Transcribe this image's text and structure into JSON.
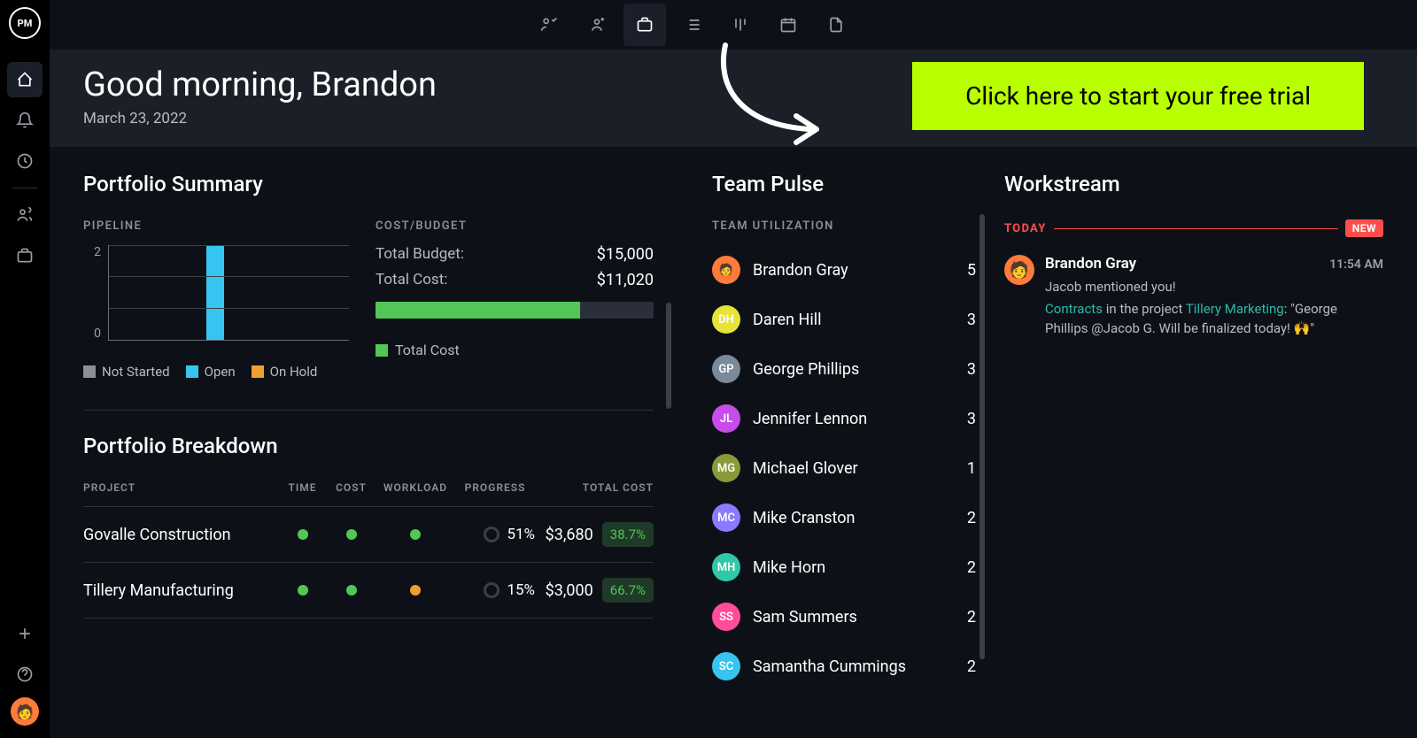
{
  "logo": "PM",
  "header": {
    "greeting": "Good morning, Brandon",
    "date": "March 23, 2022"
  },
  "cta": "Click here to start your free trial",
  "portfolio": {
    "title": "Portfolio Summary",
    "pipeline_label": "PIPELINE",
    "costbudget_label": "COST/BUDGET",
    "budget_label": "Total Budget:",
    "budget_value": "$15,000",
    "cost_label": "Total Cost:",
    "cost_value": "$11,020",
    "bar_legend": "Total Cost",
    "legend": {
      "not_started": "Not Started",
      "open": "Open",
      "on_hold": "On Hold"
    }
  },
  "chart_data": {
    "type": "bar",
    "categories": [
      "Not Started",
      "Open",
      "On Hold"
    ],
    "values": [
      0,
      3,
      0
    ],
    "ylim": [
      0,
      3
    ],
    "yticks": [
      0,
      2
    ],
    "colors": {
      "Not Started": "#8a8f99",
      "Open": "#36c5f0",
      "On Hold": "#f0a030"
    },
    "title": "Pipeline"
  },
  "breakdown": {
    "title": "Portfolio Breakdown",
    "headers": {
      "project": "PROJECT",
      "time": "TIME",
      "cost": "COST",
      "workload": "WORKLOAD",
      "progress": "PROGRESS",
      "total": "TOTAL COST"
    },
    "rows": [
      {
        "project": "Govalle Construction",
        "time": "green",
        "cost": "green",
        "workload": "green",
        "progress": "51%",
        "total": "$3,680",
        "pct": "38.7%"
      },
      {
        "project": "Tillery Manufacturing",
        "time": "green",
        "cost": "green",
        "workload": "orange",
        "progress": "15%",
        "total": "$3,000",
        "pct": "66.7%"
      }
    ]
  },
  "team": {
    "title": "Team Pulse",
    "subtitle": "TEAM UTILIZATION",
    "members": [
      {
        "initials": "",
        "name": "Brandon Gray",
        "count": "5",
        "color": "#ff7b3a",
        "emoji": "🧑"
      },
      {
        "initials": "DH",
        "name": "Daren Hill",
        "count": "3",
        "color": "#e8e337"
      },
      {
        "initials": "GP",
        "name": "George Phillips",
        "count": "3",
        "color": "#7a8a9a"
      },
      {
        "initials": "JL",
        "name": "Jennifer Lennon",
        "count": "3",
        "color": "#c84de8"
      },
      {
        "initials": "MG",
        "name": "Michael Glover",
        "count": "1",
        "color": "#8a9a3a"
      },
      {
        "initials": "MC",
        "name": "Mike Cranston",
        "count": "2",
        "color": "#8a7aff"
      },
      {
        "initials": "MH",
        "name": "Mike Horn",
        "count": "2",
        "color": "#2fc8a8"
      },
      {
        "initials": "SS",
        "name": "Sam Summers",
        "count": "2",
        "color": "#ff4d9a"
      },
      {
        "initials": "SC",
        "name": "Samantha Cummings",
        "count": "2",
        "color": "#36c5f0"
      }
    ]
  },
  "workstream": {
    "title": "Workstream",
    "today": "TODAY",
    "new": "NEW",
    "item": {
      "name": "Brandon Gray",
      "time": "11:54 AM",
      "sub": "Jacob mentioned you!",
      "link1": "Contracts",
      "mid1": " in the project ",
      "link2": "Tillery Marketing",
      "tail": ": \"George Phillips @Jacob G. Will be finalized today! 🙌\""
    }
  }
}
